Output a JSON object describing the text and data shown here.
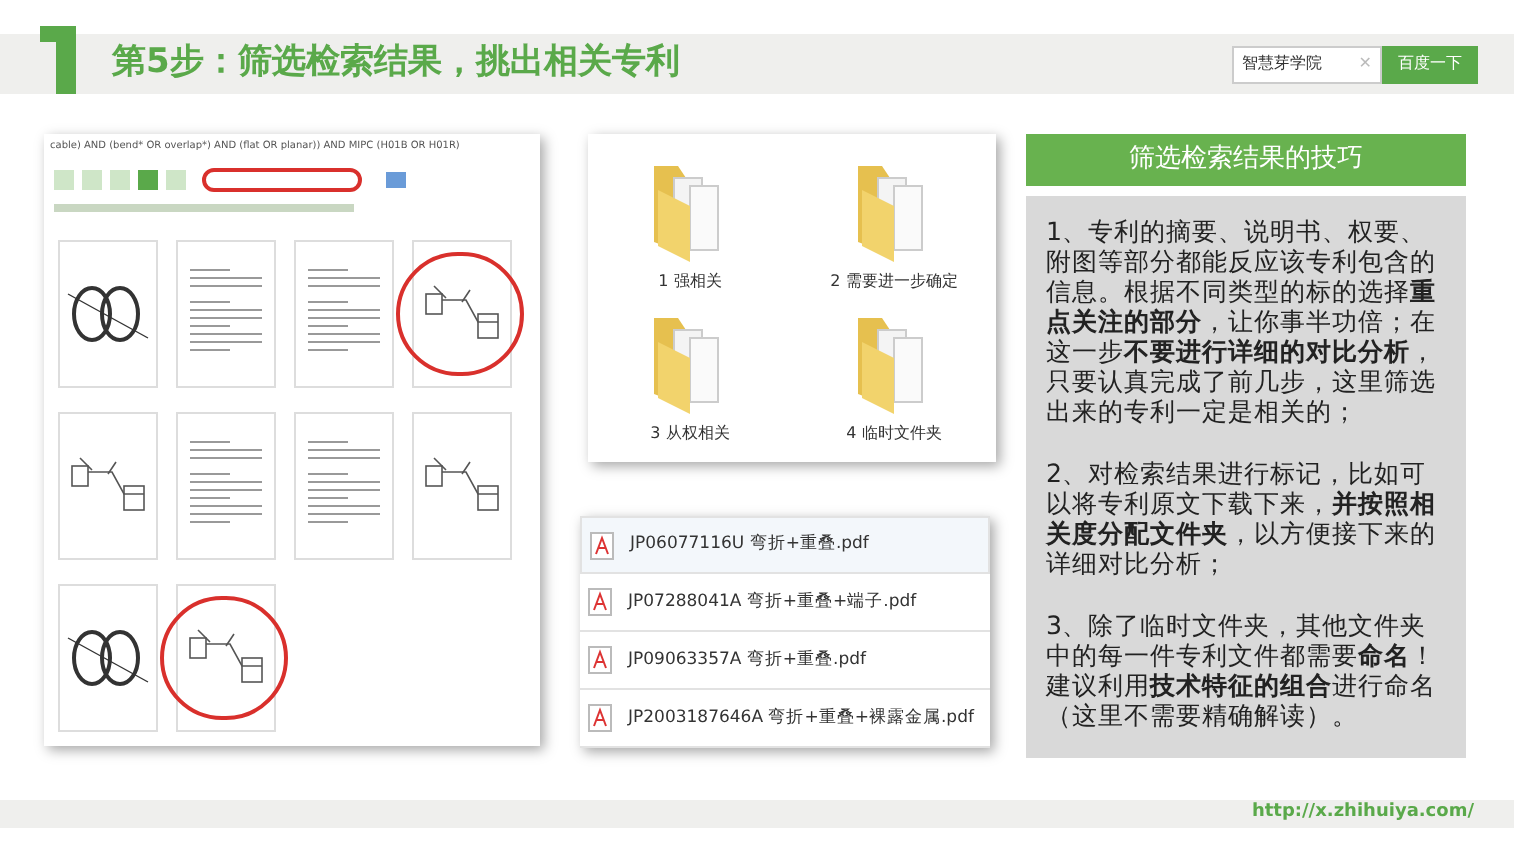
{
  "header": {
    "title": "第5步：筛选检索结果，挑出相关专利",
    "search": {
      "value": "智慧芽学院",
      "clear": "✕",
      "button": "百度一下"
    }
  },
  "screenshot": {
    "query": "cable) AND (bend* OR overlap*) AND (flat OR planar)) AND MIPC (H01B OR H01R)",
    "thumbnails": [
      {
        "kind": "rings",
        "circled": false
      },
      {
        "kind": "document",
        "circled": false
      },
      {
        "kind": "document",
        "circled": false
      },
      {
        "kind": "drawing",
        "circled": true
      },
      {
        "kind": "drawing",
        "circled": false
      },
      {
        "kind": "document",
        "circled": false
      },
      {
        "kind": "document",
        "circled": false
      },
      {
        "kind": "drawing",
        "circled": false
      },
      {
        "kind": "rings",
        "circled": false
      },
      {
        "kind": "drawing",
        "circled": true
      }
    ]
  },
  "folders": [
    {
      "name": "1 强相关"
    },
    {
      "name": "2 需要进一步确定"
    },
    {
      "name": "3 从权相关"
    },
    {
      "name": "4 临时文件夹"
    }
  ],
  "files": [
    {
      "name": "JP06077116U 弯折+重叠.pdf",
      "selected": true
    },
    {
      "name": "JP07288041A 弯折+重叠+端子.pdf",
      "selected": false
    },
    {
      "name": "JP09063357A 弯折+重叠.pdf",
      "selected": false
    },
    {
      "name": "JP2003187646A 弯折+重叠+裸露金属.pdf",
      "selected": false
    }
  ],
  "tips": {
    "title": "筛选检索结果的技巧",
    "paragraphs": [
      "1、专利的摘要、说明书、权要、附图等部分都能反应该专利包含的信息。根据不同类型的标的选择**重点关注的部分**，让你事半功倍；在这一步**不要进行详细的对比分析**，只要认真完成了前几步，这里筛选出来的专利一定是相关的；",
      "2、对检索结果进行标记，比如可以将专利原文下载下来，**并按照相关度分配文件夹**，以方便接下来的详细对比分析；",
      "3、除了临时文件夹，其他文件夹中的每一件专利文件都需要**命名**！建议利用**技术特征的组合**进行命名（这里不需要精确解读）。"
    ]
  },
  "footer": {
    "url": "http://x.zhihuiya.com/"
  }
}
